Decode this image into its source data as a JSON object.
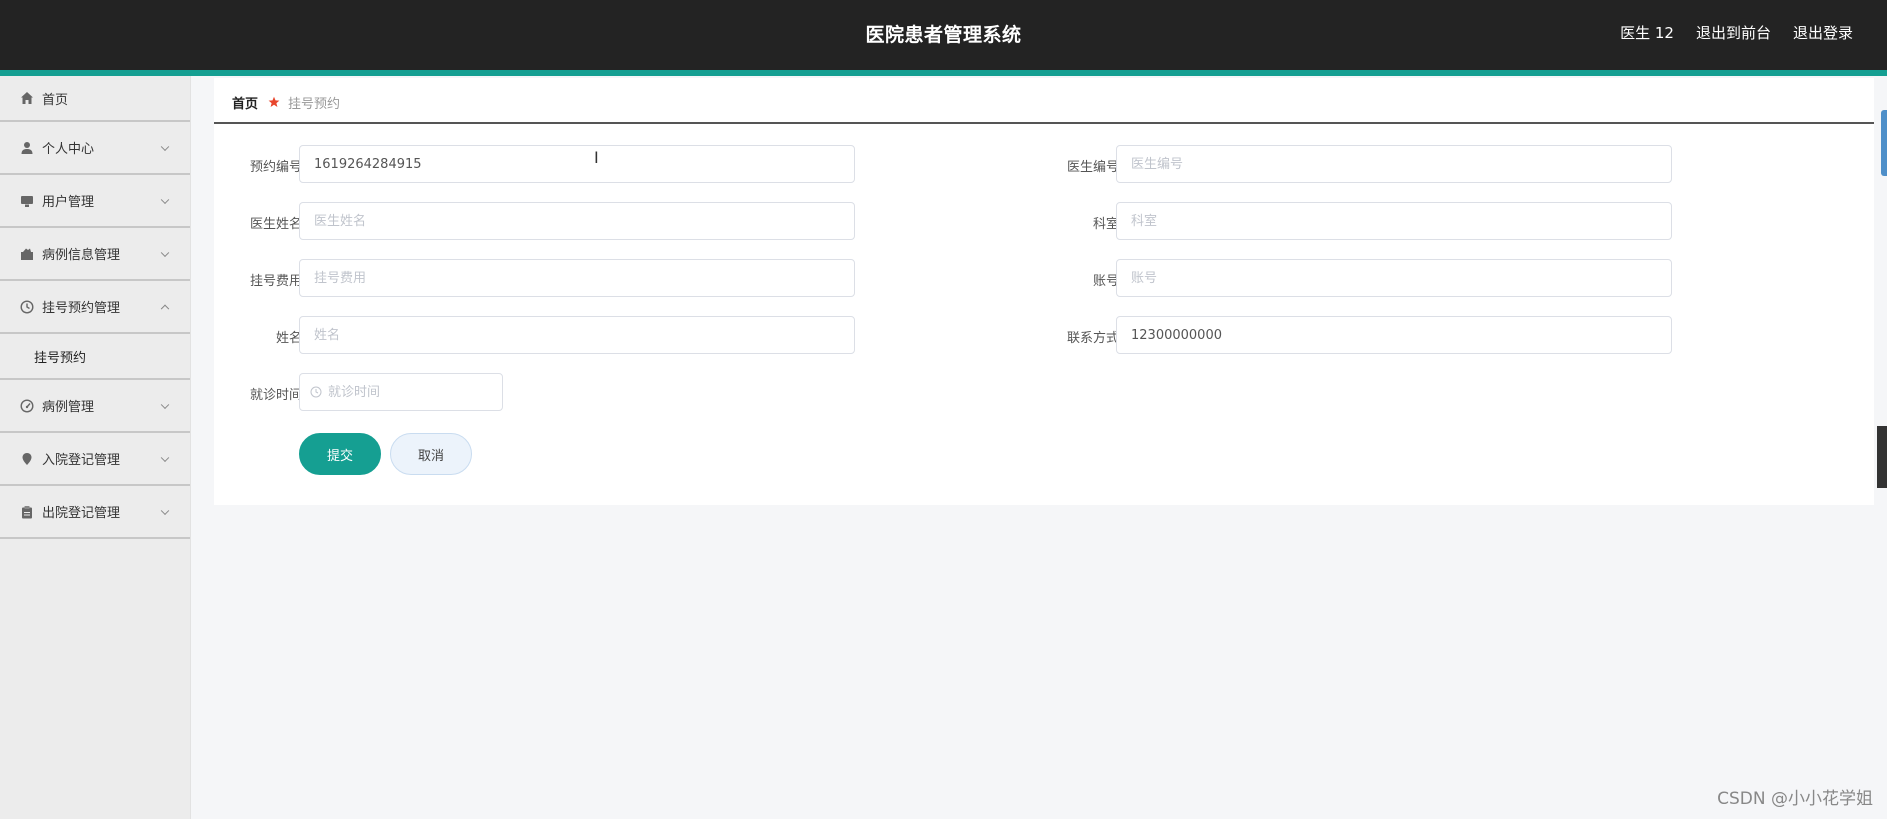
{
  "header": {
    "title": "医院患者管理系统",
    "user": "医生 12",
    "front_link": "退出到前台",
    "logout_link": "退出登录"
  },
  "sidebar": {
    "items": [
      {
        "label": "首页",
        "icon": "home-icon"
      },
      {
        "label": "个人中心",
        "icon": "user-icon"
      },
      {
        "label": "用户管理",
        "icon": "monitor-icon"
      },
      {
        "label": "病例信息管理",
        "icon": "medical-bag-icon"
      },
      {
        "label": "挂号预约管理",
        "icon": "clock-icon"
      },
      {
        "label": "病例管理",
        "icon": "gauge-icon"
      },
      {
        "label": "入院登记管理",
        "icon": "location-icon"
      },
      {
        "label": "出院登记管理",
        "icon": "clipboard-icon"
      }
    ],
    "submenu_label": "挂号预约"
  },
  "breadcrumb": {
    "home": "首页",
    "current": "挂号预约"
  },
  "form": {
    "appointment_no": {
      "label": "预约编号",
      "value": "1619264284915",
      "placeholder": ""
    },
    "doctor_no": {
      "label": "医生编号",
      "value": "",
      "placeholder": "医生编号"
    },
    "doctor_name": {
      "label": "医生姓名",
      "value": "",
      "placeholder": "医生姓名"
    },
    "department": {
      "label": "科室",
      "value": "",
      "placeholder": "科室"
    },
    "fee": {
      "label": "挂号费用",
      "value": "",
      "placeholder": "挂号费用"
    },
    "account": {
      "label": "账号",
      "value": "",
      "placeholder": "账号"
    },
    "name": {
      "label": "姓名",
      "value": "",
      "placeholder": "姓名"
    },
    "contact": {
      "label": "联系方式",
      "value": "12300000000",
      "placeholder": ""
    },
    "visit_time": {
      "label": "就诊时间",
      "value": "",
      "placeholder": "就诊时间"
    },
    "submit_label": "提交",
    "cancel_label": "取消"
  },
  "watermark": "CSDN @小小花学姐",
  "colors": {
    "header_bg": "#232323",
    "accent": "#159f92",
    "crumb_icon": "#e8452c"
  }
}
